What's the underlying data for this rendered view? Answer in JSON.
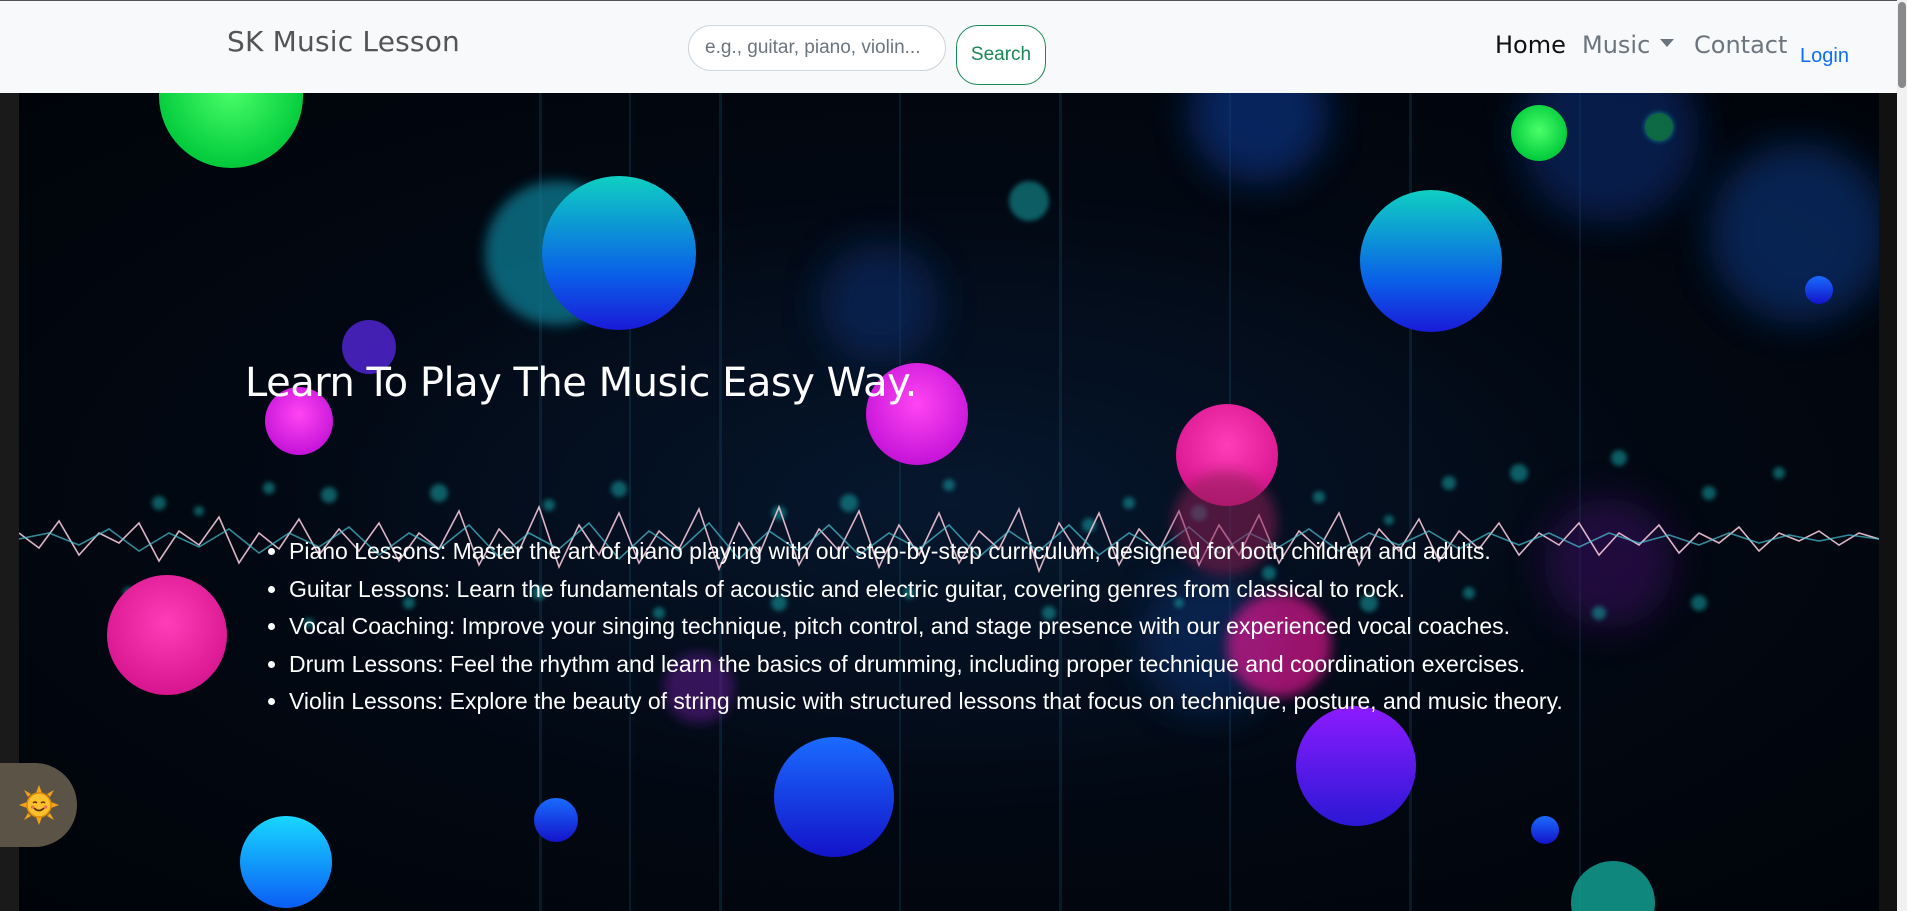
{
  "navbar": {
    "brand": "SK Music Lesson",
    "search_placeholder": "e.g., guitar, piano, violin...",
    "search_value": "",
    "search_button": "Search",
    "links": {
      "home": "Home",
      "music": "Music",
      "contact": "Contact",
      "login": "Login"
    },
    "accent_color": "#198754",
    "link_color": "#0d6efd"
  },
  "hero": {
    "title": "Learn To Play The Music Easy Way.",
    "items": [
      "Piano Lessons: Master the art of piano playing with our step-by-step curriculum, designed for both children and adults.",
      "Guitar Lessons: Learn the fundamentals of acoustic and electric guitar, covering genres from classical to rock.",
      "Vocal Coaching: Improve your singing technique, pitch control, and stage presence with our experienced vocal coaches.",
      "Drum Lessons: Feel the rhythm and learn the basics of drumming, including proper technique and coordination exercises.",
      "Violin Lessons: Explore the beauty of string music with structured lessons that focus on technique, posture, and music theory."
    ]
  },
  "widget": {
    "icon": "sun-face-icon"
  }
}
